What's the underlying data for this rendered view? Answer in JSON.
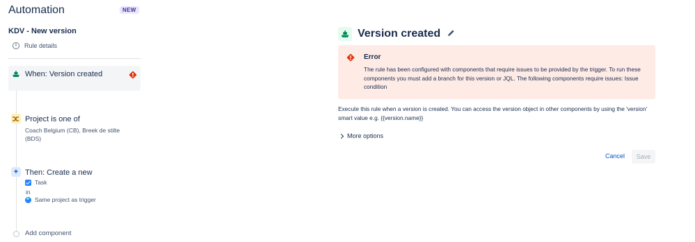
{
  "sidebar": {
    "app_title": "Automation",
    "new_badge": "NEW",
    "rule_name": "KDV - New version",
    "rule_details": "Rule details",
    "trigger": {
      "label": "When: Version created"
    },
    "condition": {
      "label": "Project is one of",
      "detail": "Coach Belgium (CB), Breek de stilte (BDS)"
    },
    "action": {
      "label": "Then: Create a new",
      "issue_type": "Task",
      "in_text": "in",
      "project": "Same project as trigger"
    },
    "add_component": "Add component"
  },
  "panel": {
    "title": "Version created",
    "error": {
      "title": "Error",
      "message": "The rule has been configured with components that require issues to be provided by the trigger. To run these components you must add a branch for this version or JQL. The following components require issues: Issue condition"
    },
    "description": "Execute this rule when a version is created. You can access the version object in other components by using the 'version' smart value e.g. {{version.name}}",
    "more_options": "More options",
    "cancel": "Cancel",
    "save": "Save"
  },
  "icons": {
    "trigger": "ship-icon",
    "warning": "warning-diamond-icon",
    "condition": "shuffle-icon",
    "action": "plus-icon",
    "edit": "pencil-icon",
    "info": "info-icon"
  },
  "colors": {
    "error_bg": "#ffebe6",
    "error_icon": "#de350b",
    "link": "#0052cc",
    "trigger_green": "#00875a"
  }
}
